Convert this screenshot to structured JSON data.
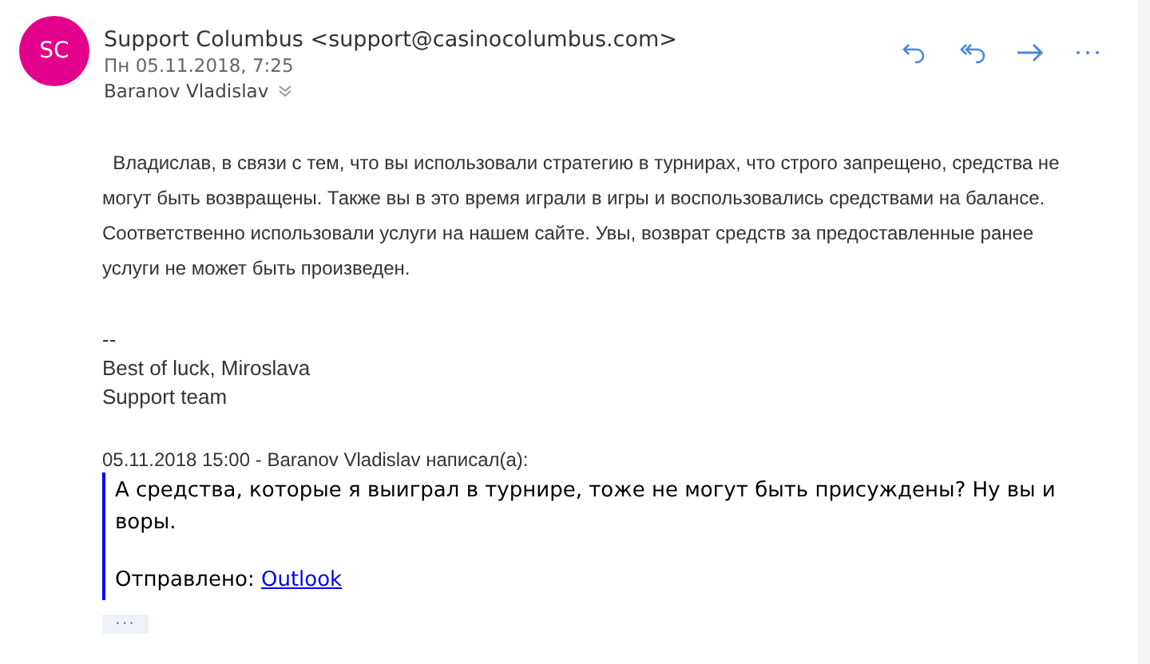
{
  "header": {
    "avatar_initials": "SC",
    "sender": "Support Columbus <support@casinocolumbus.com>",
    "date": "Пн 05.11.2018, 7:25",
    "recipient": "Baranov Vladislav"
  },
  "body": {
    "paragraph": "  Владислав, в связи с тем, что вы использовали стратегию в турнирах, что строго запрещено, средства не могут быть возвращены. Также вы в это время играли в игры и воспользовались средствами на балансе. Соответственно использовали услуги на нашем сайте. Увы, возврат средств за предоставленные ранее услуги не может быть произведен.",
    "signature": [
      "--",
      "Best of luck, Miroslava",
      "Support team"
    ],
    "quote_header": "05.11.2018 15:00 - Baranov Vladislav написал(а):",
    "quote_text": "А средства, которые я выиграл в турнире, тоже не могут быть присуждены? Ну вы и воры.",
    "sent_label": "Отправлено:",
    "sent_link": "Outlook"
  },
  "more_button": "···"
}
